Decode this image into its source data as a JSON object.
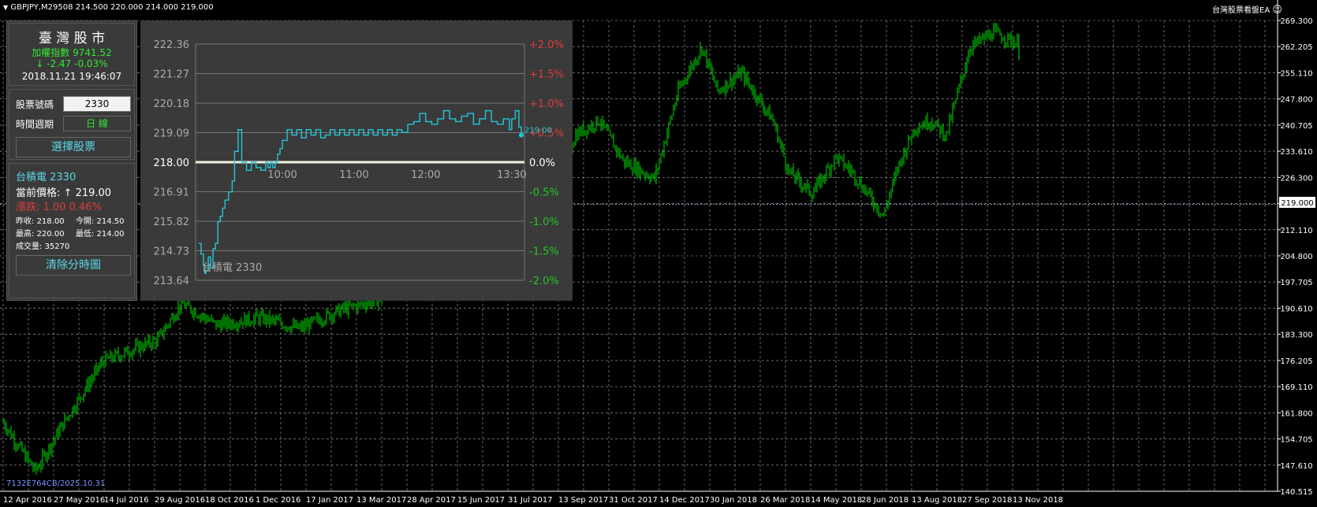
{
  "header": {
    "symbol_line": "GBPJPY,M29508  214.500 220.000 214.000 219.000",
    "ea_name": "台灣股票看盤EA",
    "smiley": "☺"
  },
  "main_chart": {
    "price_labels": [
      "269.300",
      "262.205",
      "255.110",
      "247.800",
      "240.705",
      "233.610",
      "226.300",
      "219.000",
      "212.110",
      "204.800",
      "197.705",
      "190.610",
      "183.300",
      "176.205",
      "169.110",
      "161.800",
      "154.705",
      "147.610",
      "140.515"
    ],
    "price_range": [
      140.515,
      269.3
    ],
    "current_price": "219.000",
    "current_price_value": 219.0,
    "date_labels": [
      "12 Apr 2016",
      "27 May 2016",
      "14 Jul 2016",
      "29 Aug 2016",
      "18 Oct 2016",
      "1 Dec 2016",
      "17 Jan 2017",
      "13 Mar 2017",
      "28 Apr 2017",
      "15 Jun 2017",
      "31 Jul 2017",
      "13 Sep 2017",
      "31 Oct 2017",
      "14 Dec 2017",
      "30 Jan 2018",
      "26 Mar 2018",
      "14 May 2018",
      "28 Jun 2018",
      "13 Aug 2018",
      "27 Sep 2018",
      "13 Nov 2018"
    ],
    "watermark": "7132E764CB/2025.10.31",
    "bar_color": "#00e000",
    "grid_color": "#aaaaaa",
    "price_line_color": "#8aa2c8"
  },
  "market": {
    "title": "臺 灣 股 市",
    "index_label": "加權指數",
    "index_value": "9741.52",
    "arrow": "↓",
    "change": "-2.47",
    "change_pct": "-0.03%",
    "datetime": "2018.11.21 19:46:07"
  },
  "controls": {
    "stock_code_label": "股票號碼",
    "stock_code_value": "2330",
    "period_label": "時間週期",
    "period_value": "日 線",
    "select_button": "選擇股票"
  },
  "stock": {
    "name": "台積電 2330",
    "price_label": "當前價格:",
    "price_arrow": "↑",
    "price": "219.00",
    "change_label": "漲跌:",
    "change": "1.00",
    "change_pct": "0.46%",
    "prev_close_label": "昨收:",
    "prev_close": "218.00",
    "open_label": "今開:",
    "open": "214.50",
    "high_label": "最高:",
    "high": "220.00",
    "low_label": "最低:",
    "low": "214.00",
    "volume_label": "成交量:",
    "volume": "35270",
    "clear_button": "清除分時圖"
  },
  "chart_data": {
    "type": "line",
    "title": "",
    "annotation": "台積電 2330",
    "last_label": "219.00",
    "left_ticks": [
      "222.36",
      "221.27",
      "220.18",
      "219.09",
      "218.00",
      "216.91",
      "215.82",
      "214.73",
      "213.64"
    ],
    "right_ticks": [
      "+2.0%",
      "+1.5%",
      "+1.0%",
      "+0.5%",
      "0.0%",
      "-0.5%",
      "-1.0%",
      "-1.5%",
      "-2.0%"
    ],
    "x_ticks": [
      "10:00",
      "11:00",
      "12:00",
      "13:30"
    ],
    "ylim": [
      213.64,
      222.36
    ],
    "reference": 218.0,
    "line_color": "#22c8d8",
    "positive_color": "#e03c3c",
    "negative_color": "#22c822",
    "series": [
      {
        "x": [
          0,
          2,
          4,
          5,
          6,
          8,
          10,
          12,
          14,
          16,
          18,
          20,
          22,
          25,
          28,
          30,
          33,
          36,
          40,
          44,
          48,
          52,
          56,
          58,
          60,
          62,
          64,
          66,
          68,
          70,
          74,
          78,
          82,
          86,
          90,
          94,
          98,
          102,
          106,
          110,
          114,
          118,
          122,
          126,
          130,
          134,
          138,
          142,
          146,
          150,
          154,
          158,
          162,
          166,
          170,
          175,
          180,
          185,
          190,
          195,
          200,
          205,
          210,
          215,
          220,
          225,
          230,
          235,
          240,
          245,
          250,
          255,
          260,
          262,
          265,
          268,
          270
        ],
        "y": [
          215.0,
          214.6,
          214.2,
          213.9,
          214.0,
          214.5,
          214.1,
          214.8,
          215.0,
          215.8,
          216.0,
          216.3,
          216.6,
          216.9,
          217.3,
          218.4,
          219.2,
          218.0,
          217.7,
          218.0,
          217.8,
          217.7,
          218.0,
          217.8,
          218.0,
          217.8,
          218.0,
          218.3,
          218.5,
          218.8,
          219.2,
          219.0,
          219.2,
          218.9,
          219.2,
          219.0,
          219.2,
          218.9,
          219.0,
          219.2,
          219.0,
          219.2,
          219.0,
          219.2,
          219.0,
          219.2,
          219.0,
          219.2,
          219.0,
          219.2,
          219.0,
          219.2,
          219.0,
          219.2,
          219.1,
          219.4,
          219.5,
          219.8,
          219.5,
          219.4,
          219.6,
          219.9,
          219.6,
          219.5,
          219.7,
          219.8,
          219.4,
          219.6,
          219.9,
          219.5,
          219.4,
          219.6,
          219.2,
          219.6,
          219.9,
          219.3,
          219.0
        ]
      }
    ]
  }
}
